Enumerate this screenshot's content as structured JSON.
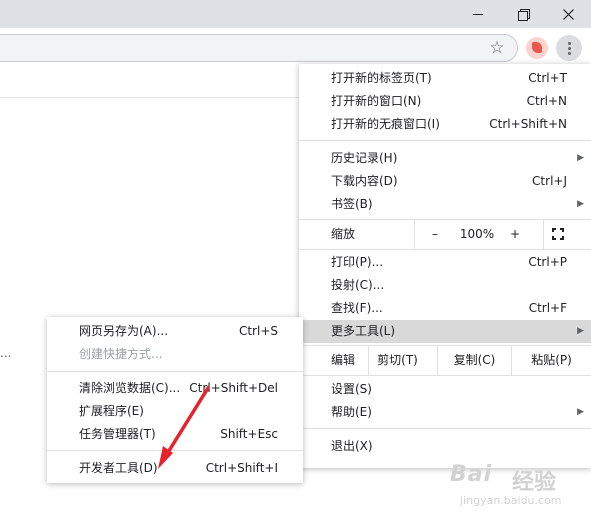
{
  "browser": {
    "menu_colors": {
      "highlight": "#d9d9d9",
      "separator": "#e0e0e0",
      "titlebar": "#dee1e6"
    }
  },
  "main_menu": {
    "new_tab": {
      "label": "打开新的标签页(T)",
      "shortcut": "Ctrl+T"
    },
    "new_window": {
      "label": "打开新的窗口(N)",
      "shortcut": "Ctrl+N"
    },
    "new_incognito": {
      "label": "打开新的无痕窗口(I)",
      "shortcut": "Ctrl+Shift+N"
    },
    "history": {
      "label": "历史记录(H)"
    },
    "downloads": {
      "label": "下载内容(D)",
      "shortcut": "Ctrl+J"
    },
    "bookmarks": {
      "label": "书签(B)"
    },
    "zoom": {
      "label": "缩放",
      "minus": "–",
      "level": "100%",
      "plus": "+"
    },
    "print": {
      "label": "打印(P)...",
      "shortcut": "Ctrl+P"
    },
    "cast": {
      "label": "投射(C)..."
    },
    "find": {
      "label": "查找(F)...",
      "shortcut": "Ctrl+F"
    },
    "more_tools": {
      "label": "更多工具(L)"
    },
    "edit": {
      "label": "编辑",
      "cut": "剪切(T)",
      "copy": "复制(C)",
      "paste": "粘贴(P)"
    },
    "settings": {
      "label": "设置(S)"
    },
    "help": {
      "label": "帮助(E)"
    },
    "exit": {
      "label": "退出(X)"
    }
  },
  "sub_menu": {
    "save_page": {
      "label": "网页另存为(A)...",
      "shortcut": "Ctrl+S"
    },
    "create_shortcut": {
      "label": "创建快捷方式..."
    },
    "clear_data": {
      "label": "清除浏览数据(C)...",
      "shortcut": "Ctrl+Shift+Del"
    },
    "extensions": {
      "label": "扩展程序(E)"
    },
    "task_manager": {
      "label": "任务管理器(T)",
      "shortcut": "Shift+Esc"
    },
    "dev_tools": {
      "label": "开发者工具(D)",
      "shortcut": "Ctrl+Shift+I"
    }
  },
  "page": {
    "ellipsis": "..."
  },
  "watermark": {
    "logo": "Bai",
    "text": "经验",
    "url": "jingyan.baidu.com"
  }
}
